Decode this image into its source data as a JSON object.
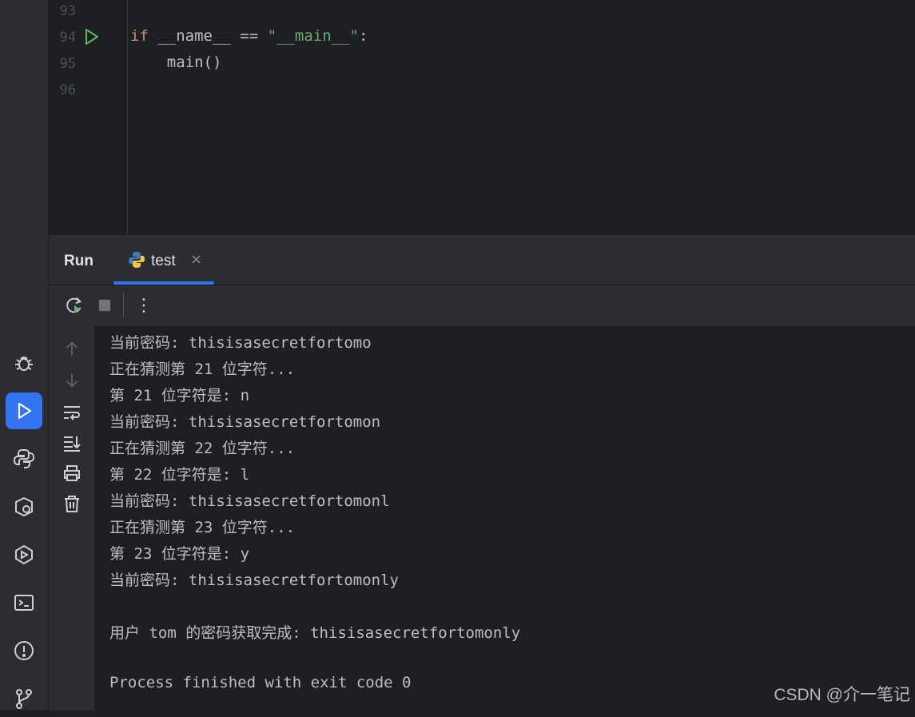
{
  "editor": {
    "lines": [
      {
        "number": "93",
        "code": ""
      },
      {
        "number": "94",
        "tokens": [
          "if",
          " __name__ == ",
          "\"__main__\"",
          ":"
        ]
      },
      {
        "number": "95",
        "code": "    main()"
      },
      {
        "number": "96",
        "code": ""
      }
    ]
  },
  "run_window": {
    "title": "Run",
    "tab_label": "test",
    "tab_close": "×",
    "more_glyph": "⋮"
  },
  "console": {
    "lines": [
      "当前密码: thisisasecretfortomo",
      "正在猜测第 21 位字符...",
      "第 21 位字符是: n",
      "当前密码: thisisasecretfortomon",
      "正在猜测第 22 位字符...",
      "第 22 位字符是: l",
      "当前密码: thisisasecretfortomonl",
      "正在猜测第 23 位字符...",
      "第 23 位字符是: y",
      "当前密码: thisisasecretfortomonly",
      "",
      "用户 tom 的密码获取完成: thisisasecretfortomonly",
      "",
      "Process finished with exit code 0"
    ]
  },
  "watermark": "CSDN @介一笔记",
  "colors": {
    "accent": "#3574f0",
    "keyword": "#cf8e6d",
    "string": "#6aab73",
    "background": "#1e1f22",
    "panel": "#2b2d30"
  }
}
